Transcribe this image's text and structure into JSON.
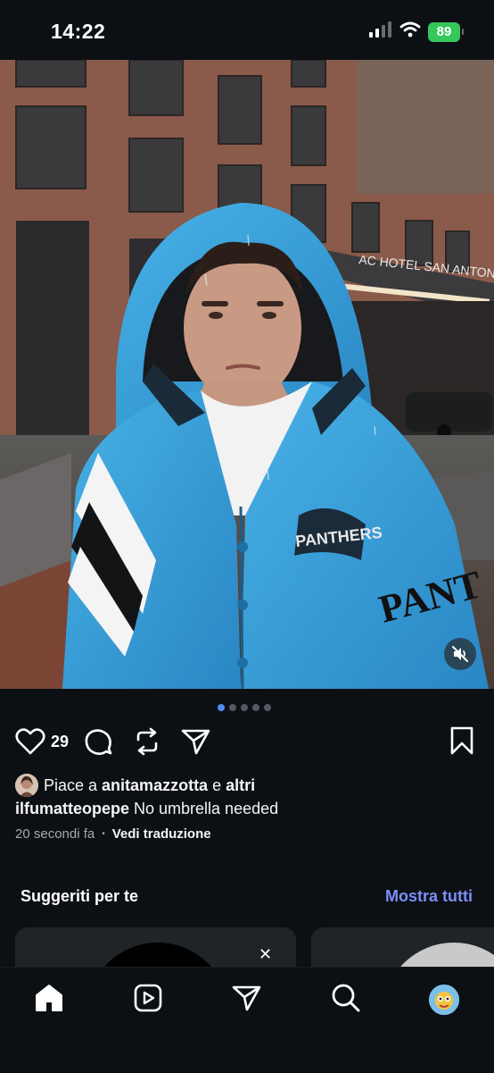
{
  "status_bar": {
    "time": "14:22",
    "battery": "89",
    "icons": [
      "signal-icon",
      "wifi-icon",
      "battery-icon"
    ]
  },
  "post": {
    "media": {
      "description_icon": "mute-icon",
      "carousel": {
        "count": 5,
        "active_index": 0
      }
    },
    "actions": {
      "like_count": "29",
      "icons": [
        "heart-icon",
        "comment-icon",
        "repost-icon",
        "share-icon",
        "bookmark-icon"
      ]
    },
    "likes": {
      "prefix": "Piace a ",
      "user": "anitamazzotta",
      "connector": " e ",
      "others": "altri"
    },
    "caption": {
      "username": "ilfumatteopepe",
      "text": " No umbrella needed"
    },
    "time_ago": "20 secondi fa",
    "separator": "•",
    "translate_label": "Vedi traduzione"
  },
  "suggested": {
    "title": "Suggeriti per te",
    "see_all": "Mostra tutti",
    "close_symbol": "✕"
  },
  "bottom_nav": {
    "items": [
      "home-icon",
      "reels-icon",
      "messages-icon",
      "search-icon",
      "profile-avatar"
    ]
  },
  "colors": {
    "background": "#0c1014",
    "accent_link": "#7b8ff7",
    "carousel_active": "#4f8cf7",
    "battery": "#34c759",
    "jacket": "#2f9bd6"
  }
}
